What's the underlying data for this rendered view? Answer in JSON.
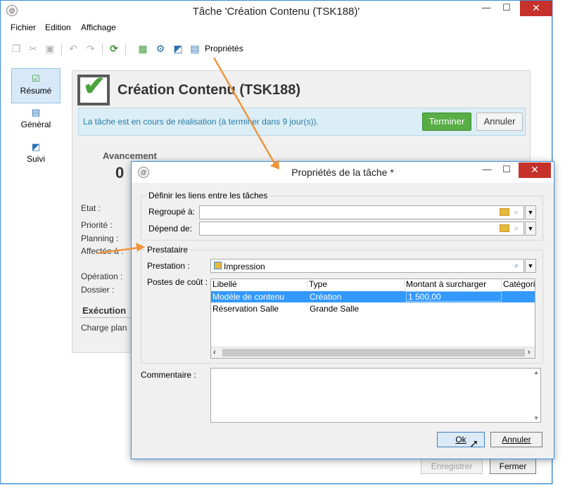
{
  "main_window": {
    "title": "Tâche 'Création Contenu (TSK188)'",
    "controls": {
      "minimize": "—",
      "maximize": "☐",
      "close": "✕"
    },
    "menu": [
      "Fichier",
      "Edition",
      "Affichage"
    ],
    "toolbar": {
      "properties_label": "Propriétés"
    },
    "nav": [
      {
        "label": "Résumé",
        "icon": "check-icon"
      },
      {
        "label": "Général",
        "icon": "clipboard-icon"
      },
      {
        "label": "Suivi",
        "icon": "tracking-icon"
      }
    ],
    "task_title": "Création Contenu (TSK188)",
    "status_message": "La tâche est en cours de réalisation (à terminer dans 9 jour(s)).",
    "terminer_label": "Terminer",
    "annuler_label": "Annuler",
    "avancement_label": "Avancement",
    "avancement_value": "0",
    "fields": [
      "Etat :",
      "Priorité :",
      "Planning :",
      "Affectée à :",
      "Opération :",
      "Dossier :"
    ],
    "execution_label": "Exécution",
    "charge_label": "Charge plan",
    "enregistrer_label": "Enregistrer",
    "fermer_label": "Fermer"
  },
  "dialog": {
    "title": "Propriétés de la tâche *",
    "controls": {
      "minimize": "—",
      "maximize": "☐",
      "close": "✕"
    },
    "links_group": {
      "title": "Définir les liens entre les tâches",
      "regroupe_label": "Regroupé à:",
      "depend_label": "Dépend de:"
    },
    "prestataire_group": {
      "title": "Prestataire",
      "prestation_label": "Prestation :",
      "prestation_value": "Impression",
      "postes_label": "Postes de coût :",
      "columns": [
        "Libellé",
        "Type",
        "Montant à surcharger",
        "Catégori"
      ],
      "rows": [
        {
          "libelle": "Modèle de contenu",
          "type": "Création",
          "montant": "1 500,00",
          "categorie": ""
        },
        {
          "libelle": "Réservation Salle",
          "type": "Grande Salle",
          "montant": "",
          "categorie": ""
        }
      ]
    },
    "commentaire_label": "Commentaire :",
    "ok_label": "Ok",
    "annuler_label": "Annuler"
  },
  "colors": {
    "accent_blue": "#3a8fe0",
    "close_red": "#c7312b",
    "terminer_green": "#58ad45",
    "arrow_orange": "#f0953c",
    "selection_blue": "#3399ff"
  }
}
